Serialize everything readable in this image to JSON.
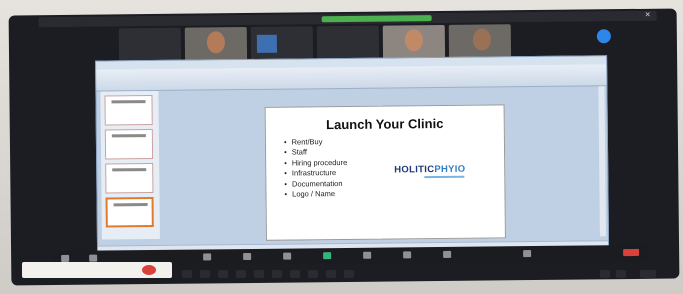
{
  "slide": {
    "title": "Launch Your Clinic",
    "bullets": [
      "Rent/Buy",
      "Staff",
      "Hiring procedure",
      "Infrastructure",
      "Documentation",
      "Logo / Name"
    ],
    "logo_part1": "HOLI",
    "logo_part2": "TIC",
    "logo_part3": "PHYIO"
  },
  "colors": {
    "recording_green": "#4caf50",
    "logo_navy": "#1f3a78",
    "logo_blue": "#2f7ec4",
    "zoom_info_blue": "#2d86e8"
  }
}
